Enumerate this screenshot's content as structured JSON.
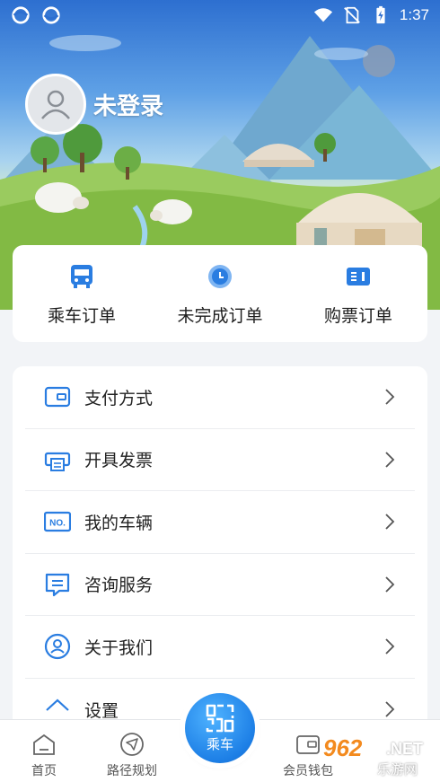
{
  "status_bar": {
    "time": "1:37"
  },
  "profile": {
    "name": "未登录"
  },
  "orders": [
    {
      "label": "乘车订单",
      "icon": "bus-icon"
    },
    {
      "label": "未完成订单",
      "icon": "clock-icon"
    },
    {
      "label": "购票订单",
      "icon": "ticket-icon"
    }
  ],
  "menu": [
    {
      "label": "支付方式",
      "icon": "wallet-icon"
    },
    {
      "label": "开具发票",
      "icon": "printer-icon"
    },
    {
      "label": "我的车辆",
      "icon": "license-plate-icon"
    },
    {
      "label": "咨询服务",
      "icon": "message-icon"
    },
    {
      "label": "关于我们",
      "icon": "user-circle-icon"
    },
    {
      "label": "设置",
      "icon": "settings-icon"
    }
  ],
  "bottom_nav": {
    "home": "首页",
    "route": "路径规划",
    "ride": "乘车",
    "wallet": "会员钱包"
  },
  "watermark": {
    "number": "962",
    "net": ".NET",
    "sub": "乐游网"
  },
  "colors": {
    "accent": "#1d7fe6",
    "icon_blue": "#2a7de1",
    "background": "#f2f4f7"
  }
}
